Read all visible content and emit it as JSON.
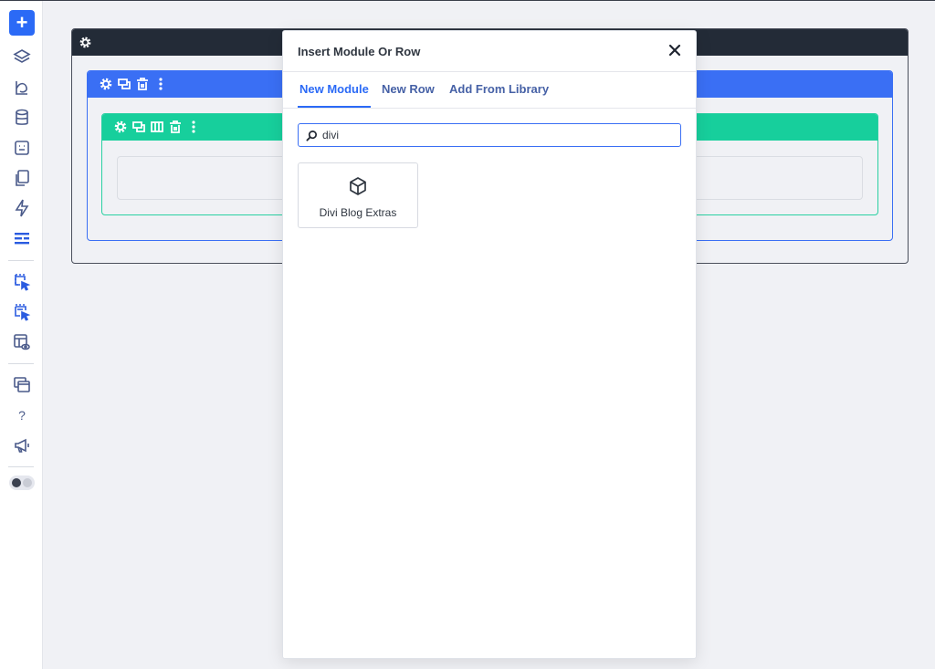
{
  "modal": {
    "title": "Insert Module Or Row",
    "close_icon": "close-icon",
    "tabs": [
      {
        "label": "New Module",
        "active": true
      },
      {
        "label": "New Row",
        "active": false
      },
      {
        "label": "Add From Library",
        "active": false
      }
    ],
    "search": {
      "value": "divi",
      "icon": "search-icon"
    },
    "modules": [
      {
        "label": "Divi Blog Extras",
        "icon": "cube-icon"
      }
    ]
  },
  "sidebar": {
    "add_icon": "+",
    "items": [
      {
        "icon": "layers-icon"
      },
      {
        "icon": "palette-icon"
      },
      {
        "icon": "database-icon"
      },
      {
        "icon": "template-icon"
      },
      {
        "icon": "pages-icon"
      },
      {
        "icon": "lightning-icon"
      },
      {
        "icon": "settings-sliders-icon"
      },
      {
        "icon": "select-element-icon"
      },
      {
        "icon": "select-multiple-icon"
      },
      {
        "icon": "preview-layout-icon"
      },
      {
        "icon": "windows-icon"
      },
      {
        "icon": "help-icon"
      },
      {
        "icon": "megaphone-icon"
      }
    ],
    "help_text": "?"
  },
  "colors": {
    "accent": "#2b6af6",
    "section_bar": "#232b37",
    "row_bar": "#3a6ff4",
    "column_bar": "#17cf9c"
  }
}
